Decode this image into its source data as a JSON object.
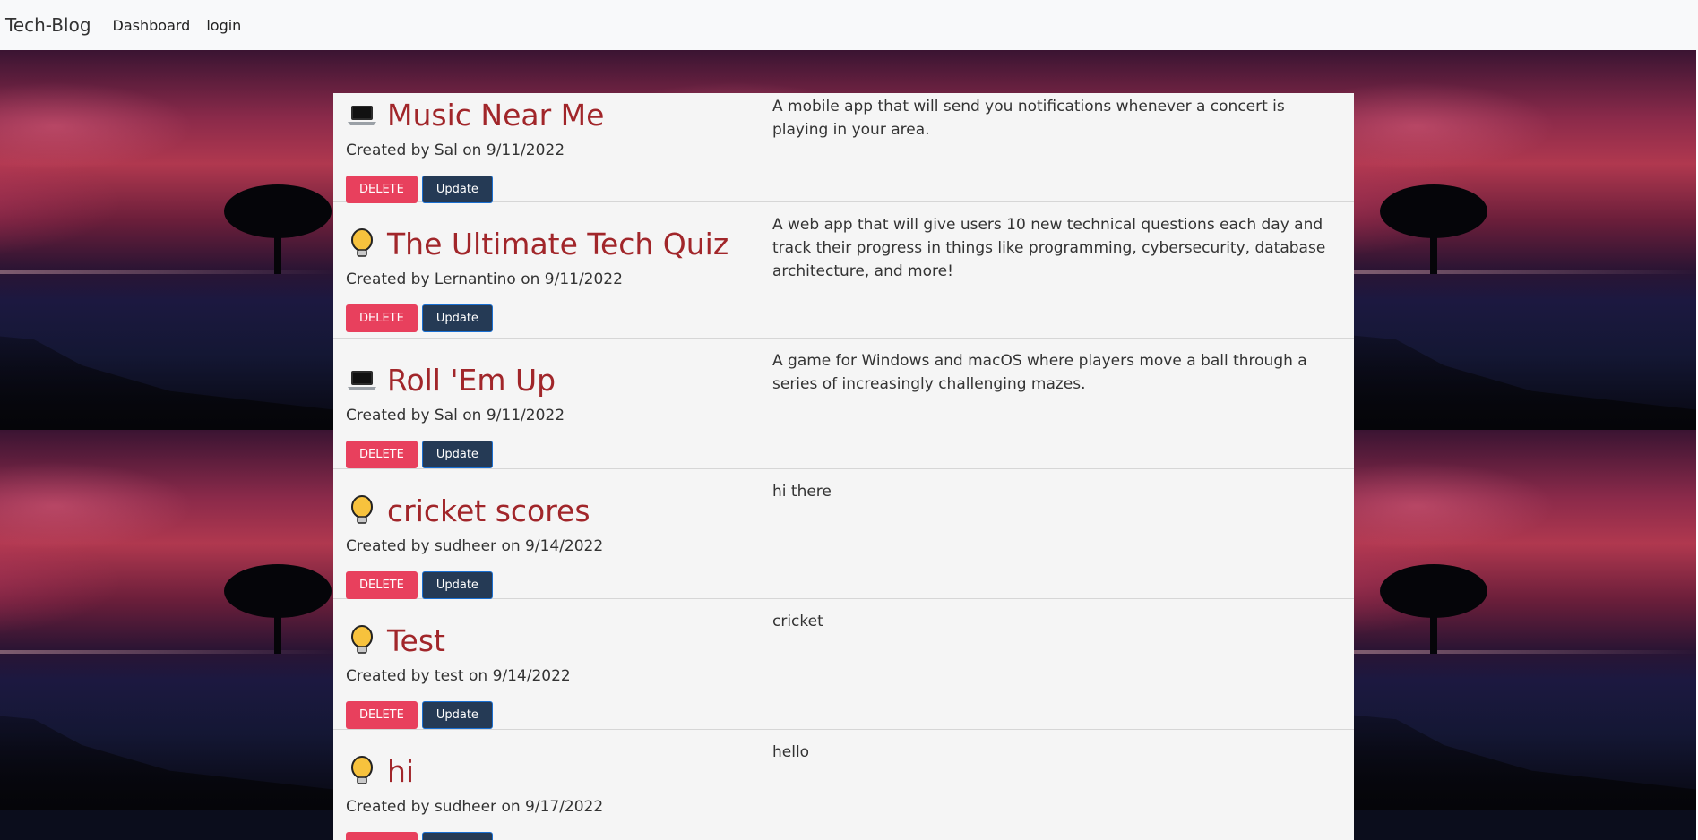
{
  "navbar": {
    "brand": "Tech-Blog",
    "links": [
      "Dashboard",
      "login"
    ]
  },
  "buttons": {
    "delete": "DELETE",
    "update": "Update"
  },
  "posts": [
    {
      "icon": "laptop-icon",
      "title": "Music Near Me",
      "meta": "Created by Sal on 9/11/2022",
      "description": "A mobile app that will send you notifications whenever a concert is playing in your area."
    },
    {
      "icon": "lightbulb-icon",
      "title": "The Ultimate Tech Quiz",
      "meta": "Created by Lernantino on 9/11/2022",
      "description": "A web app that will give users 10 new technical questions each day and track their progress in things like programming, cybersecurity, database architecture, and more!"
    },
    {
      "icon": "laptop-icon",
      "title": "Roll 'Em Up",
      "meta": "Created by Sal on 9/11/2022",
      "description": "A game for Windows and macOS where players move a ball through a series of increasingly challenging mazes."
    },
    {
      "icon": "lightbulb-icon",
      "title": "cricket scores",
      "meta": "Created by sudheer on 9/14/2022",
      "description": "hi there"
    },
    {
      "icon": "lightbulb-icon",
      "title": "Test",
      "meta": "Created by test on 9/14/2022",
      "description": "cricket"
    },
    {
      "icon": "lightbulb-icon",
      "title": "hi",
      "meta": "Created by sudheer on 9/17/2022",
      "description": "hello"
    }
  ],
  "colors": {
    "title": "#a1262a",
    "delete": "#e8405d",
    "update": "#253a55",
    "navbar": "#f8f9fa",
    "panel": "#f5f5f5"
  }
}
